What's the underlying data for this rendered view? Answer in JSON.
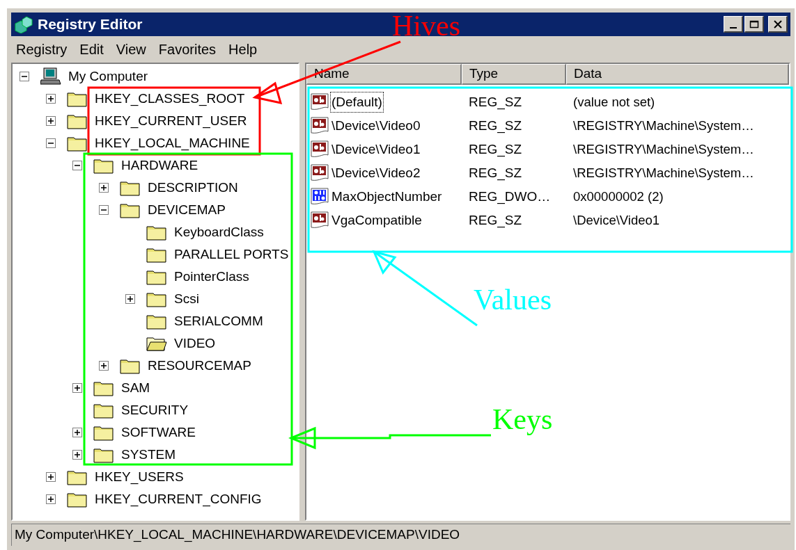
{
  "window": {
    "title": "Registry Editor"
  },
  "menu": [
    "Registry",
    "Edit",
    "View",
    "Favorites",
    "Help"
  ],
  "tree": [
    {
      "label": "My Computer",
      "kind": "computer",
      "expanded": true,
      "selected": false,
      "children": [
        {
          "label": "HKEY_CLASSES_ROOT",
          "kind": "folder",
          "expanded": false,
          "selected": false
        },
        {
          "label": "HKEY_CURRENT_USER",
          "kind": "folder",
          "expanded": false,
          "selected": false
        },
        {
          "label": "HKEY_LOCAL_MACHINE",
          "kind": "folder",
          "expanded": true,
          "selected": false,
          "children": [
            {
              "label": "HARDWARE",
              "kind": "folder",
              "expanded": true,
              "selected": false,
              "children": [
                {
                  "label": "DESCRIPTION",
                  "kind": "folder",
                  "expanded": false,
                  "selected": false
                },
                {
                  "label": "DEVICEMAP",
                  "kind": "folder",
                  "expanded": true,
                  "selected": false,
                  "children": [
                    {
                      "label": "KeyboardClass",
                      "kind": "folder",
                      "selected": false
                    },
                    {
                      "label": "PARALLEL PORTS",
                      "kind": "folder",
                      "selected": false
                    },
                    {
                      "label": "PointerClass",
                      "kind": "folder",
                      "selected": false
                    },
                    {
                      "label": "Scsi",
                      "kind": "folder",
                      "expanded": false,
                      "selected": false
                    },
                    {
                      "label": "SERIALCOMM",
                      "kind": "folder",
                      "selected": false
                    },
                    {
                      "label": "VIDEO",
                      "kind": "folder",
                      "selected": true
                    }
                  ]
                },
                {
                  "label": "RESOURCEMAP",
                  "kind": "folder",
                  "expanded": false,
                  "selected": false
                }
              ]
            },
            {
              "label": "SAM",
              "kind": "folder",
              "expanded": false,
              "selected": false
            },
            {
              "label": "SECURITY",
              "kind": "folder",
              "selected": false
            },
            {
              "label": "SOFTWARE",
              "kind": "folder",
              "expanded": false,
              "selected": false
            },
            {
              "label": "SYSTEM",
              "kind": "folder",
              "expanded": false,
              "selected": false
            }
          ]
        },
        {
          "label": "HKEY_USERS",
          "kind": "folder",
          "expanded": false,
          "selected": false
        },
        {
          "label": "HKEY_CURRENT_CONFIG",
          "kind": "folder",
          "expanded": false,
          "selected": false
        }
      ]
    }
  ],
  "values": {
    "columns": [
      "Name",
      "Type",
      "Data"
    ],
    "rows": [
      {
        "kind": "string",
        "name": "(Default)",
        "type": "REG_SZ",
        "data": "(value not set)",
        "focused": true
      },
      {
        "kind": "string",
        "name": "\\Device\\Video0",
        "type": "REG_SZ",
        "data": "\\REGISTRY\\Machine\\System…",
        "focused": false
      },
      {
        "kind": "string",
        "name": "\\Device\\Video1",
        "type": "REG_SZ",
        "data": "\\REGISTRY\\Machine\\System…",
        "focused": false
      },
      {
        "kind": "string",
        "name": "\\Device\\Video2",
        "type": "REG_SZ",
        "data": "\\REGISTRY\\Machine\\System…",
        "focused": false
      },
      {
        "kind": "dword",
        "name": "MaxObjectNumber",
        "type": "REG_DWO…",
        "data": "0x00000002 (2)",
        "focused": false
      },
      {
        "kind": "string",
        "name": "VgaCompatible",
        "type": "REG_SZ",
        "data": "\\Device\\Video1",
        "focused": false
      }
    ]
  },
  "status_bar": "My Computer\\HKEY_LOCAL_MACHINE\\HARDWARE\\DEVICEMAP\\VIDEO",
  "annotations": [
    {
      "label": "Hives",
      "color": "#ff0000"
    },
    {
      "label": "Values",
      "color": "#00ffff"
    },
    {
      "label": "Keys",
      "color": "#00ff00"
    }
  ]
}
